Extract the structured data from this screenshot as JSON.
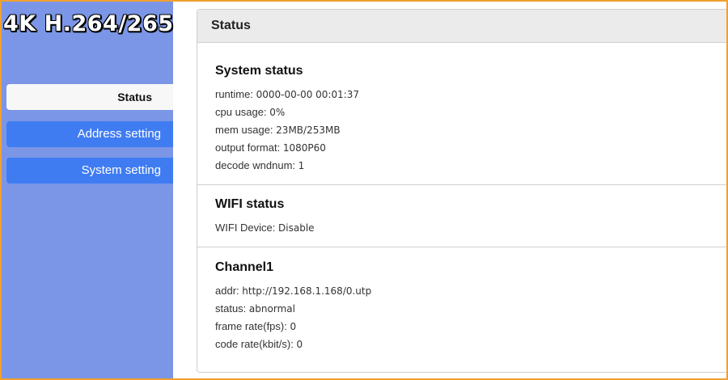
{
  "brand": "4K H.264/265",
  "nav": [
    {
      "label": "Status",
      "active": true
    },
    {
      "label": "Address setting",
      "active": false
    },
    {
      "label": "System setting",
      "active": false
    }
  ],
  "panel": {
    "title": "Status",
    "sections": [
      {
        "title": "System status",
        "rows": [
          {
            "label": "runtime:",
            "value": "0000-00-00 00:01:37"
          },
          {
            "label": "cpu usage:",
            "value": "0%"
          },
          {
            "label": "mem usage:",
            "value": "23MB/253MB"
          },
          {
            "label": "output format:",
            "value": "1080P60"
          },
          {
            "label": "decode wndnum:",
            "value": "1"
          }
        ]
      },
      {
        "title": "WIFI status",
        "rows": [
          {
            "label": "WIFI Device:",
            "value": "Disable"
          }
        ]
      },
      {
        "title": "Channel1",
        "rows": [
          {
            "label": "addr:",
            "value": "http://192.168.1.168/0.utp"
          },
          {
            "label": "status:",
            "value": "abnormal"
          },
          {
            "label": "frame rate(fps):",
            "value": "0"
          },
          {
            "label": "code rate(kbit/s):",
            "value": "0"
          }
        ]
      }
    ]
  },
  "colors": {
    "sidebar": "#7b96e6",
    "nav_button": "#3f7cf2",
    "nav_active": "#f7f7f7",
    "frame_border": "#f0a030",
    "panel_header": "#ebebeb"
  }
}
